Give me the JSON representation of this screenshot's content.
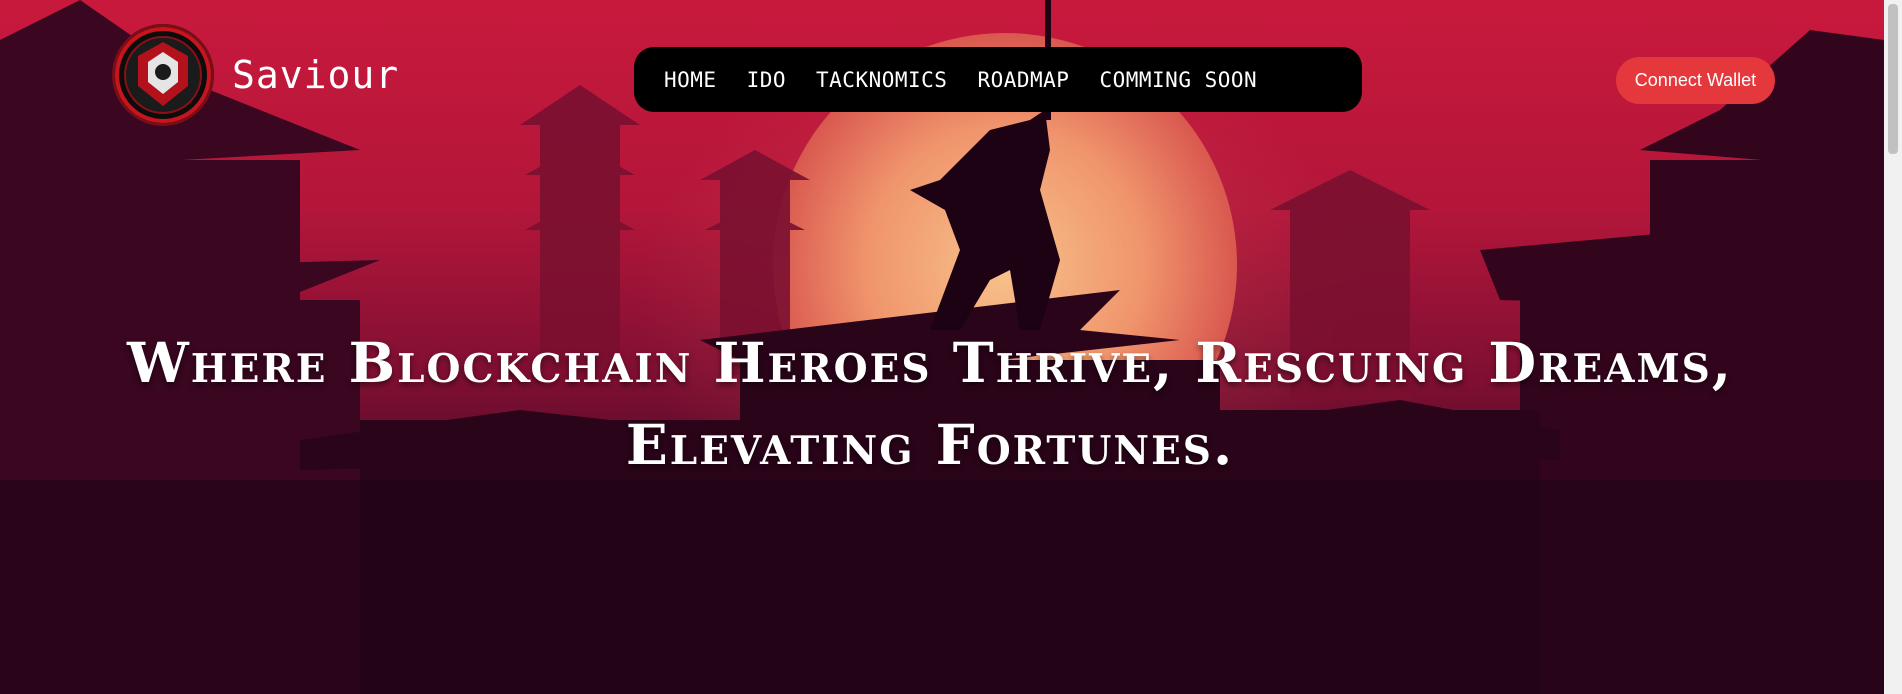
{
  "brand": {
    "name": "Saviour",
    "logo_icon": "saviour-emblem-icon"
  },
  "nav": {
    "items": [
      {
        "label": "HOME"
      },
      {
        "label": "IDO"
      },
      {
        "label": "TACKNOMICS"
      },
      {
        "label": "ROADMAP"
      },
      {
        "label": "COMMING SOON"
      }
    ]
  },
  "header": {
    "connect_wallet_label": "Connect Wallet"
  },
  "hero": {
    "title": "Where Blockchain Heroes Thrive, Rescuing Dreams, Elevating Fortunes."
  },
  "colors": {
    "accent": "#e5383d",
    "nav_bg": "#000000",
    "sky": "#c8193c",
    "sun": "#f2a27a",
    "silhouette": "#2a0419"
  }
}
